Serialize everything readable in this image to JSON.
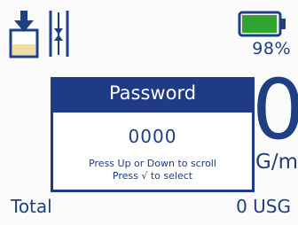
{
  "status": {
    "battery_percent": "98%",
    "battery_level": 0.98,
    "battery_color": "#2fa52f"
  },
  "icons": {
    "left": "tank-fill-icon",
    "right": "valve-icon"
  },
  "rate": {
    "value": "0",
    "unit": "G/m"
  },
  "dialog": {
    "title": "Password",
    "value": "0000",
    "hint_line1": "Press Up or Down to scroll",
    "hint_line2": "Press √ to select"
  },
  "total": {
    "label": "Total",
    "value": "0 USG"
  },
  "colors": {
    "primary": "#1f3f83",
    "dialog_header": "#1f3a86",
    "tank_fill": "#efdca6"
  }
}
